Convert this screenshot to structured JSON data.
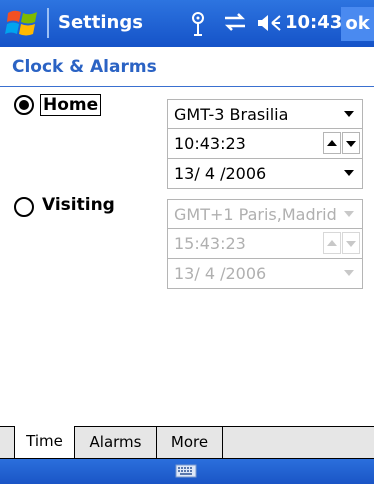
{
  "titlebar": {
    "title": "Settings",
    "clock": "10:43",
    "ok_label": "ok",
    "icons": [
      "windows-start-flag-icon",
      "antenna-icon",
      "sync-icon",
      "speaker-icon"
    ]
  },
  "page": {
    "header": "Clock & Alarms"
  },
  "home": {
    "label": "Home",
    "selected": true,
    "timezone": "GMT-3 Brasilia",
    "time": "10:43:23",
    "date": "13/ 4 /2006"
  },
  "visiting": {
    "label": "Visiting",
    "selected": false,
    "timezone": "GMT+1 Paris,Madrid",
    "time": "15:43:23",
    "date": "13/ 4 /2006"
  },
  "tabs": [
    {
      "label": "Time",
      "active": true
    },
    {
      "label": "Alarms",
      "active": false
    },
    {
      "label": "More",
      "active": false
    }
  ],
  "colors": {
    "titlebar": "#1f62d6",
    "header_text": "#2b63c4",
    "disabled_text": "#b0b0b0"
  },
  "bottombar": {
    "icon": "keyboard-icon"
  }
}
